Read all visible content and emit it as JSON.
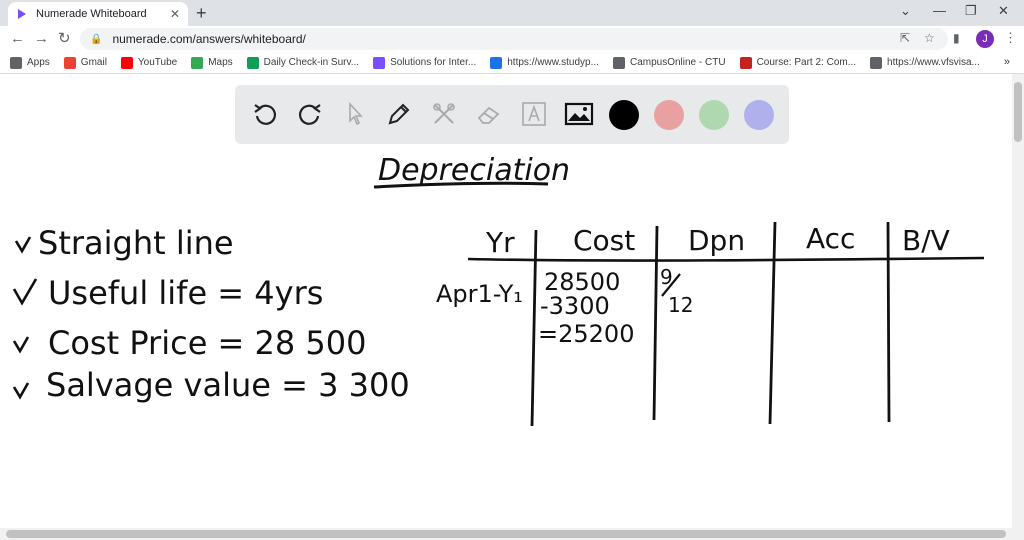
{
  "browser": {
    "tab_title": "Numerade Whiteboard",
    "tab_close": "✕",
    "new_tab": "+",
    "url": "numerade.com/answers/whiteboard/",
    "profile_initial": "J"
  },
  "bookmarks": [
    {
      "label": "Apps",
      "color": "#5f6368"
    },
    {
      "label": "Gmail",
      "color": "#ea4335"
    },
    {
      "label": "YouTube",
      "color": "#ff0000"
    },
    {
      "label": "Maps",
      "color": "#34a853"
    },
    {
      "label": "Daily Check-in Surv...",
      "color": "#0f9d58"
    },
    {
      "label": "Solutions for Inter...",
      "color": "#7b4fff"
    },
    {
      "label": "https://www.studyp...",
      "color": "#1a73e8"
    },
    {
      "label": "CampusOnline - CTU",
      "color": "#5f6368"
    },
    {
      "label": "Course: Part 2: Com...",
      "color": "#c5221f"
    },
    {
      "label": "https://www.vfsvisa...",
      "color": "#5f6368"
    }
  ],
  "toolbar": {
    "tools": [
      "undo-icon",
      "redo-icon",
      "pointer-icon",
      "pen-icon",
      "tools-icon",
      "eraser-icon",
      "text-icon",
      "image-icon"
    ],
    "colors": [
      "#000000",
      "#e8a0a0",
      "#b0d8b0",
      "#b0b0ec"
    ]
  },
  "whiteboard": {
    "title": "Depreciation",
    "notes": [
      "Straight line",
      "Useful life = 4yrs",
      "Cost Price = 28 500",
      "Salvage value = 3 300"
    ],
    "table_headers": [
      "Yr",
      "Cost",
      "Dpn",
      "Acc",
      "B/V"
    ],
    "row_year": "Apr1-Y₁",
    "cost_lines": [
      "28500",
      "-3300",
      "=25200"
    ],
    "dpn_fraction": [
      "9",
      "12"
    ]
  }
}
